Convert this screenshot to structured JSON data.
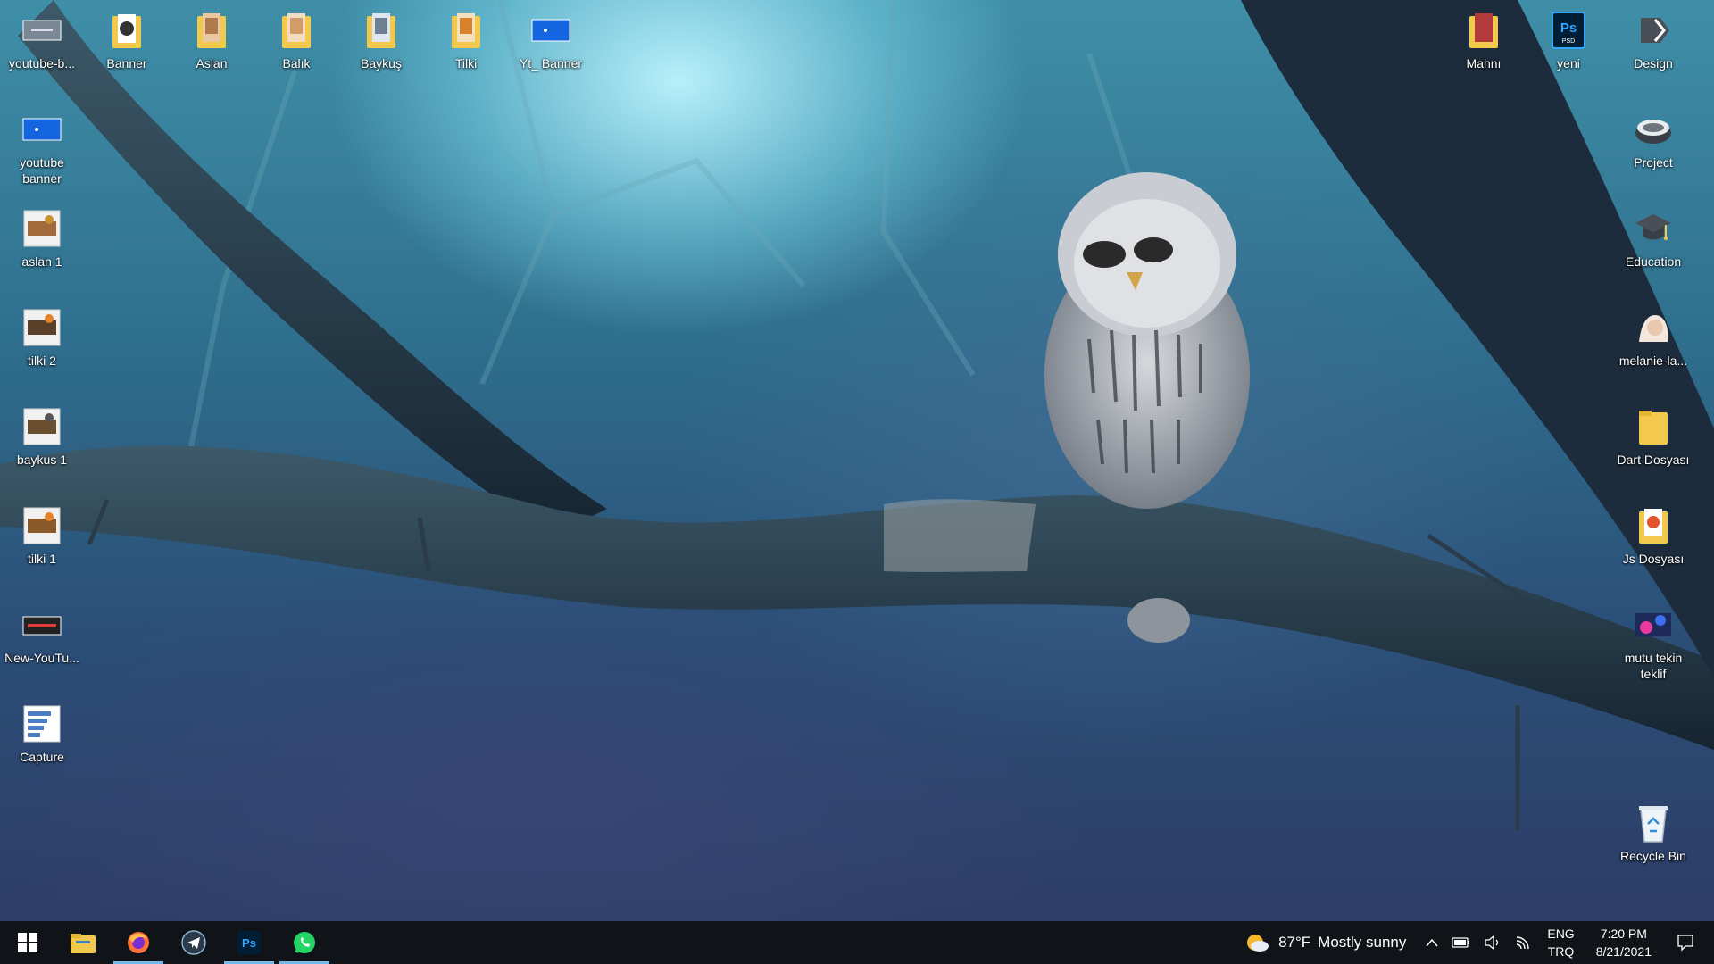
{
  "desktop": {
    "icons_top": [
      {
        "label": "youtube-b...",
        "icon": "image-file-icon"
      },
      {
        "label": "Banner",
        "icon": "folder-icon"
      },
      {
        "label": "Aslan",
        "icon": "folder-icon"
      },
      {
        "label": "Balık",
        "icon": "folder-icon"
      },
      {
        "label": "Baykuş",
        "icon": "folder-icon"
      },
      {
        "label": "Tilki",
        "icon": "folder-icon"
      },
      {
        "label": "Yt_ Banner",
        "icon": "image-file-icon"
      }
    ],
    "icons_left": [
      {
        "label": "youtube banner",
        "icon": "image-file-icon"
      },
      {
        "label": "aslan 1",
        "icon": "image-file-icon"
      },
      {
        "label": "tilki 2",
        "icon": "image-file-icon"
      },
      {
        "label": "baykus 1",
        "icon": "image-file-icon"
      },
      {
        "label": "tilki 1",
        "icon": "image-file-icon"
      },
      {
        "label": "New-YouTu...",
        "icon": "image-file-icon"
      },
      {
        "label": "Capture",
        "icon": "image-file-icon"
      }
    ],
    "icons_right_top": [
      {
        "label": "Mahnı",
        "icon": "folder-icon"
      },
      {
        "label": "yeni",
        "icon": "photoshop-file-icon"
      },
      {
        "label": "Design",
        "icon": "design-folder-icon"
      }
    ],
    "icons_right": [
      {
        "label": "Project",
        "icon": "project-folder-icon"
      },
      {
        "label": "Education",
        "icon": "graduation-cap-icon"
      },
      {
        "label": "melanie-la...",
        "icon": "image-file-icon"
      },
      {
        "label": "Dart Dosyası",
        "icon": "folder-icon"
      },
      {
        "label": "Js Dosyası",
        "icon": "folder-icon"
      },
      {
        "label": "mutu tekin teklif",
        "icon": "image-file-icon"
      },
      {
        "label": "Recycle Bin",
        "icon": "recycle-bin-icon"
      }
    ]
  },
  "taskbar": {
    "apps": [
      {
        "name": "start",
        "icon": "windows-start-icon",
        "active": false
      },
      {
        "name": "file-explorer",
        "icon": "file-explorer-icon",
        "active": false
      },
      {
        "name": "firefox",
        "icon": "firefox-icon",
        "active": true
      },
      {
        "name": "telegram",
        "icon": "telegram-icon",
        "active": false
      },
      {
        "name": "photoshop",
        "icon": "photoshop-icon",
        "active": true
      },
      {
        "name": "whatsapp",
        "icon": "whatsapp-icon",
        "active": true
      }
    ],
    "weather": {
      "temp": "87°F",
      "condition": "Mostly sunny"
    },
    "language": {
      "line1": "ENG",
      "line2": "TRQ"
    },
    "clock": {
      "time": "7:20 PM",
      "date": "8/21/2021"
    }
  },
  "colors": {
    "taskbar_bg": "#101418",
    "active_indicator": "#76b9ed",
    "folder": "#f2c94c",
    "photoshop": "#31a8ff",
    "whatsapp": "#25d366"
  }
}
